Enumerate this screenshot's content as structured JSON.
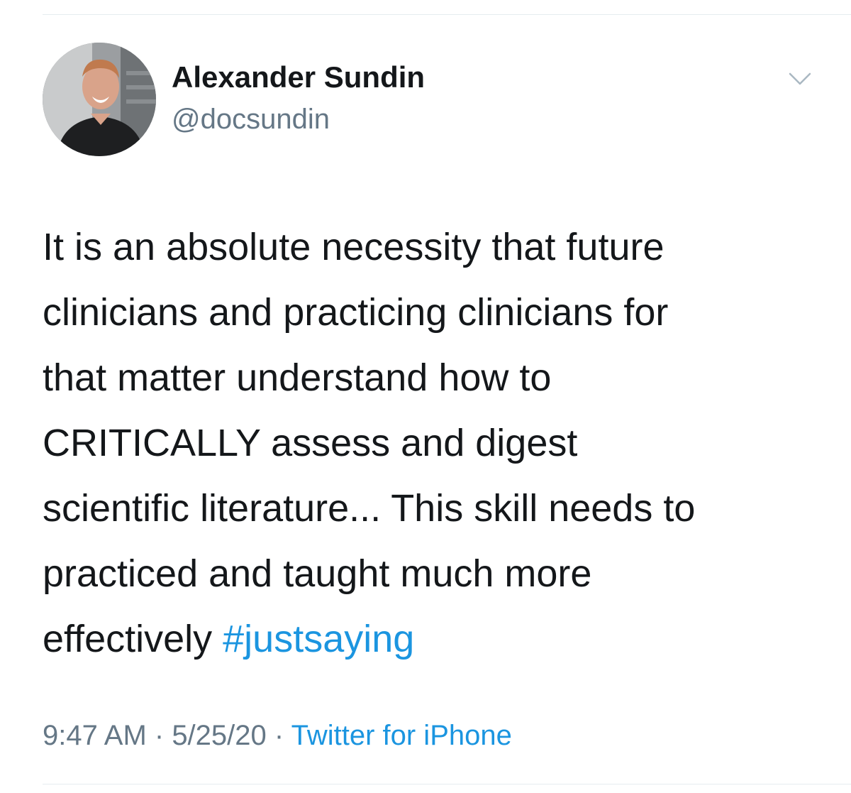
{
  "author": {
    "display_name": "Alexander Sundin",
    "handle": "@docsundin",
    "avatar_icon": "profile-photo"
  },
  "menu": {
    "icon": "chevron-down-icon"
  },
  "tweet": {
    "lines": [
      "It is an absolute necessity that future",
      "clinicians and practicing clinicians for",
      "that matter understand how to",
      "CRITICALLY assess and digest",
      "scientific literature... This skill needs to",
      "practiced and taught much more",
      "effectively "
    ],
    "hashtag": "#justsaying"
  },
  "meta": {
    "time": "9:47 AM",
    "separator": " · ",
    "date": "5/25/20",
    "source": "Twitter for iPhone"
  },
  "colors": {
    "link": "#1b95e0",
    "secondary_text": "#657786",
    "primary_text": "#14171a",
    "divider": "#e6ecf0"
  }
}
